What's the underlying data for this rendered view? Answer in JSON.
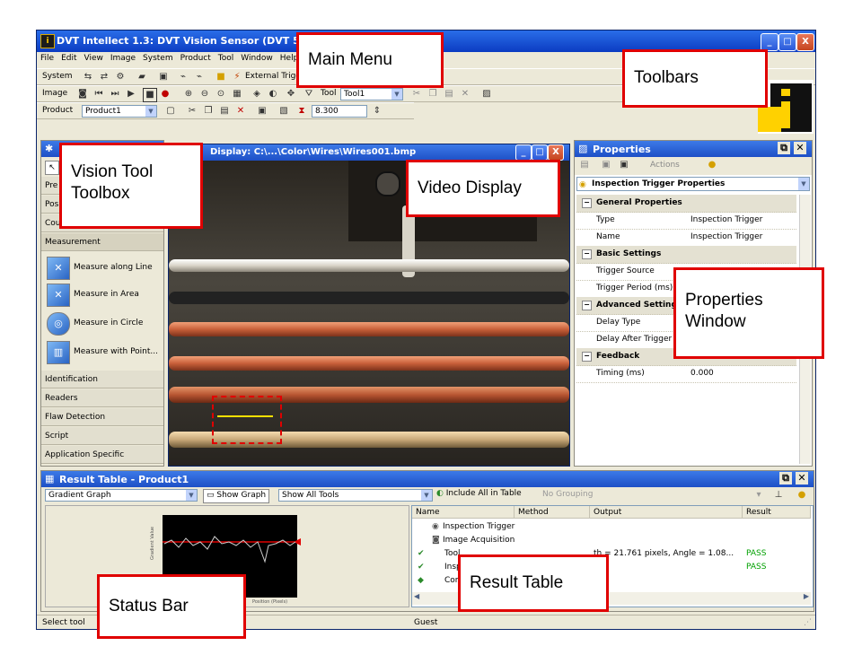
{
  "app": {
    "title": "DVT Intellect 1.3: DVT Vision Sensor (DVT 542C Em",
    "window_buttons": [
      "_",
      "□",
      "X"
    ]
  },
  "menu": [
    "File",
    "Edit",
    "View",
    "Image",
    "System",
    "Product",
    "Tool",
    "Window",
    "Help"
  ],
  "toolbars": {
    "system_label": "System",
    "trigger_label": "External Trigger",
    "image_label": "Image",
    "tool_label": "Tool",
    "tool_select": "Tool1",
    "product_label": "Product",
    "product_select": "Product1",
    "exposure_value": "8.300"
  },
  "toolbox": {
    "title": "Vision Tool Toolbox",
    "categories_top": [
      "Pre",
      "Pos",
      "Cou"
    ],
    "measurement_label": "Measurement",
    "tools": [
      "Measure along Line",
      "Measure in Area",
      "Measure in Circle",
      "Measure with Point..."
    ],
    "categories_bottom": [
      "Identification",
      "Readers",
      "Flaw Detection",
      "Script",
      "Application Specific"
    ]
  },
  "video": {
    "title": "Display: C:\\...\\Color\\Wires\\Wires001.bmp"
  },
  "properties": {
    "title": "Properties",
    "actions_label": "Actions",
    "selector": "Inspection Trigger Properties",
    "rows": [
      {
        "type": "group",
        "key": "General Properties",
        "value": ""
      },
      {
        "type": "row",
        "key": "Type",
        "value": "Inspection Trigger"
      },
      {
        "type": "row",
        "key": "Name",
        "value": "Inspection Trigger"
      },
      {
        "type": "group",
        "key": "Basic Settings",
        "value": ""
      },
      {
        "type": "row",
        "key": "Trigger Source",
        "value": ""
      },
      {
        "type": "row",
        "key": "Trigger Period (ms)",
        "value": ""
      },
      {
        "type": "group",
        "key": "Advanced Setting",
        "value": ""
      },
      {
        "type": "row",
        "key": "Delay Type",
        "value": ""
      },
      {
        "type": "row",
        "key": "Delay After Trigger (",
        "value": ""
      },
      {
        "type": "group",
        "key": "Feedback",
        "value": ""
      },
      {
        "type": "row",
        "key": "Timing (ms)",
        "value": "0.000"
      }
    ]
  },
  "result": {
    "title": "Result Table - Product1",
    "graph_select": "Gradient Graph",
    "show_graph": "Show Graph",
    "tools_select": "Show All Tools",
    "include_all": "Include All in Table",
    "grouping": "No Grouping",
    "columns": [
      "Name",
      "Method",
      "Output",
      "Result"
    ],
    "rows": [
      {
        "name": "Inspection Trigger",
        "method": "",
        "output": "",
        "result": ""
      },
      {
        "name": "Image Acquisition",
        "method": "",
        "output": "",
        "result": ""
      },
      {
        "name": "Tool",
        "method": "",
        "output": "th = 21.761 pixels, Angle = 1.08...",
        "result": "PASS"
      },
      {
        "name": "Insp",
        "method": "",
        "output": "",
        "result": "PASS"
      },
      {
        "name": "Com",
        "method": "",
        "output": "",
        "result": ""
      }
    ],
    "graph_xlabel": "Position (Pixels)",
    "graph_ylabel": "Gradient Value"
  },
  "status": {
    "left": "Select tool",
    "user": "Guest"
  },
  "callouts": {
    "main_menu": "Main Menu",
    "toolbars": "Toolbars",
    "toolbox": [
      "Vision Tool",
      "Toolbox"
    ],
    "video": "Video Display",
    "properties": [
      "Properties",
      "Window"
    ],
    "status": "Status Bar",
    "result": "Result Table"
  },
  "colors": {
    "title_blue": "#0b3cc2",
    "callout_border": "#e00000",
    "pass_green": "#00a000"
  }
}
